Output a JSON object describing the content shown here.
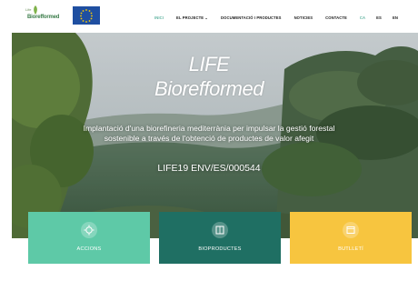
{
  "header": {
    "logo_small": "Life",
    "logo_word": "Biorefformed",
    "nav": [
      {
        "label": "INICI",
        "active": true
      },
      {
        "label": "EL PROJECTE ⌄",
        "active": false
      },
      {
        "label": "DOCUMENTACIÓ I PRODUCTES",
        "active": false
      },
      {
        "label": "NOTICIES",
        "active": false
      },
      {
        "label": "CONTACTE",
        "active": false
      }
    ],
    "languages": [
      "CA",
      "ES",
      "EN"
    ]
  },
  "hero": {
    "title_line1": "LIFE",
    "title_line2": "Biorefformed",
    "description_line1": "Implantació d'una biorefineria mediterrània per impulsar la gestió forestal",
    "description_line2": "sostenible a través de l'obtenció de productes de valor afegit",
    "code": "LIFE19 ENV/ES/000544"
  },
  "cards": [
    {
      "label": "ACCIONS",
      "icon": "gear-icon",
      "color": "#5ec9a7"
    },
    {
      "label": "BIOPRODUCTES",
      "icon": "book-icon",
      "color": "#1f6f63"
    },
    {
      "label": "BUTLLETÍ",
      "icon": "newsletter-icon",
      "color": "#f7c53f"
    }
  ],
  "colors": {
    "accent": "#5fb3a0",
    "eu_blue": "#1f4fa1",
    "eu_star": "#ffcc00"
  }
}
